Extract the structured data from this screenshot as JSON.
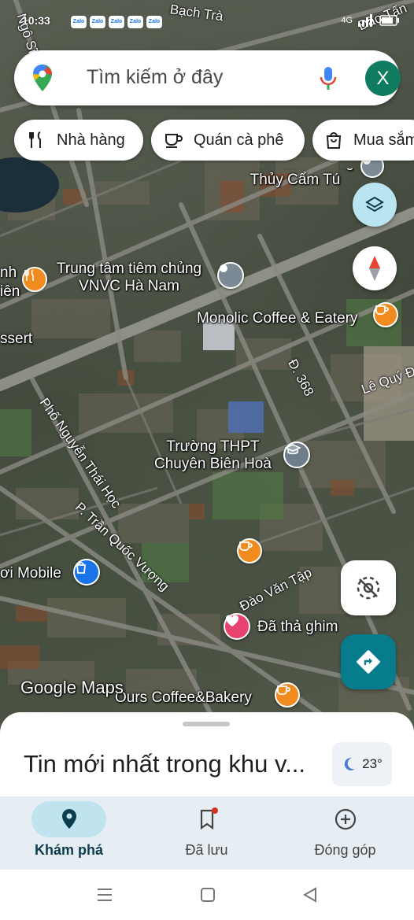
{
  "status_bar": {
    "time": "10:33",
    "app_badges": [
      "Zalo",
      "Zalo",
      "Zalo",
      "Zalo",
      "Zalo"
    ],
    "network_label": "4G"
  },
  "search": {
    "placeholder": "Tìm kiếm ở đây",
    "account_initial": "X"
  },
  "categories": [
    {
      "label": "Nhà hàng",
      "icon": "fork-knife-icon"
    },
    {
      "label": "Quán cà phê",
      "icon": "coffee-cup-icon"
    },
    {
      "label": "Mua sắm",
      "icon": "shopping-bag-icon"
    }
  ],
  "map": {
    "places": {
      "phong_thuy": "Phan Nam Phong\nThủy Cẩm Tú",
      "vnvc": "Trung tâm tiêm chủng\nVNVC Hà Nam",
      "monolic": "Monolic Coffee & Eatery",
      "truong_thpt": "Trường THPT\nChuyên Biên Hoà",
      "mobile": "ơi Mobile",
      "pinned": "Đã thả ghim",
      "ours_coffee": "Ours Coffee&Bakery",
      "left_nh": "nh",
      "left_ien": "iên",
      "left_essert": "ssert"
    },
    "roads": {
      "bach_tra": "Bạch Trà",
      "dao_tan": "Đào Tấn",
      "ngo_si_lien": "Ngô Sĩ Liên",
      "d368": "Đ. 368",
      "le_quy_don": "Lê Quý Đ",
      "nguyen_thai_hoc": "Phố Nguyễn Thái Học",
      "tran_quoc_vuong": "P. Trần Quốc Vượng",
      "dao_van_tap": "Đào Văn Tập"
    },
    "watermark": "Google Maps"
  },
  "sheet": {
    "headline": "Tin mới nhất trong khu v...",
    "temperature": "23°"
  },
  "bottom_nav": [
    {
      "label": "Khám phá",
      "icon": "location-pin-icon",
      "active": true
    },
    {
      "label": "Đã lưu",
      "icon": "bookmark-icon",
      "active": false
    },
    {
      "label": "Đóng góp",
      "icon": "add-circle-icon",
      "active": false
    }
  ],
  "colors": {
    "accent": "#0b3d4c",
    "active_pill": "#bfe3ef",
    "avatar": "#0f7b5f",
    "directions_button": "#077c8c",
    "layers_button": "#b9e4f0"
  }
}
